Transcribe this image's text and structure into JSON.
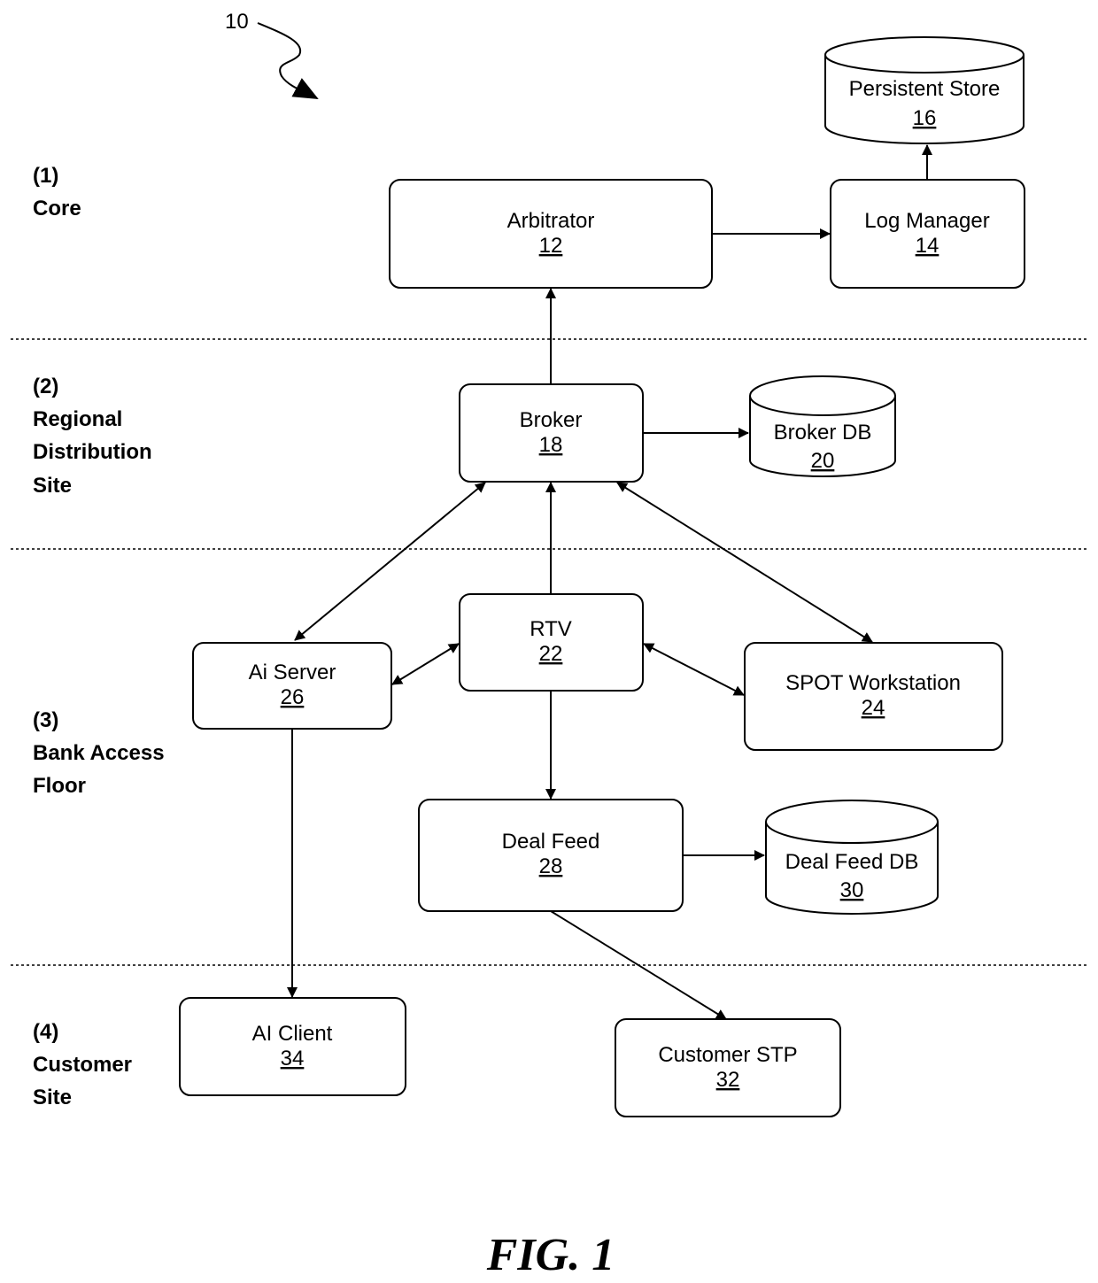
{
  "figure": {
    "caption": "FIG. 1",
    "reference_numeral": "10"
  },
  "tiers": [
    {
      "id": "core",
      "lines": [
        "(1)",
        "Core"
      ]
    },
    {
      "id": "regional",
      "lines": [
        "(2)",
        "Regional",
        "Distribution",
        "Site"
      ]
    },
    {
      "id": "bank",
      "lines": [
        "(3)",
        "Bank Access",
        "Floor"
      ]
    },
    {
      "id": "customer",
      "lines": [
        "(4)",
        "Customer",
        "Site"
      ]
    }
  ],
  "nodes": {
    "arbitrator": {
      "label": "Arbitrator",
      "ref": "12",
      "shape": "box"
    },
    "log_manager": {
      "label": "Log Manager",
      "ref": "14",
      "shape": "box"
    },
    "persistent_store": {
      "label": "Persistent Store",
      "ref": "16",
      "shape": "database"
    },
    "broker": {
      "label": "Broker",
      "ref": "18",
      "shape": "box"
    },
    "broker_db": {
      "label": "Broker DB",
      "ref": "20",
      "shape": "database"
    },
    "rtv": {
      "label": "RTV",
      "ref": "22",
      "shape": "box"
    },
    "spot_workstation": {
      "label": "SPOT Workstation",
      "ref": "24",
      "shape": "box"
    },
    "ai_server": {
      "label": "Ai Server",
      "ref": "26",
      "shape": "box"
    },
    "deal_feed": {
      "label": "Deal Feed",
      "ref": "28",
      "shape": "box"
    },
    "deal_feed_db": {
      "label": "Deal Feed DB",
      "ref": "30",
      "shape": "database"
    },
    "customer_stp": {
      "label": "Customer STP",
      "ref": "32",
      "shape": "box"
    },
    "ai_client": {
      "label": "AI Client",
      "ref": "34",
      "shape": "box"
    }
  },
  "edges": [
    {
      "from": "arbitrator",
      "to": "log_manager",
      "direction": "forward"
    },
    {
      "from": "log_manager",
      "to": "persistent_store",
      "direction": "forward"
    },
    {
      "from": "broker",
      "to": "arbitrator",
      "direction": "forward"
    },
    {
      "from": "broker",
      "to": "broker_db",
      "direction": "forward"
    },
    {
      "from": "ai_server",
      "to": "broker",
      "direction": "both"
    },
    {
      "from": "rtv",
      "to": "broker",
      "direction": "forward"
    },
    {
      "from": "spot_workstation",
      "to": "broker",
      "direction": "both"
    },
    {
      "from": "ai_server",
      "to": "rtv",
      "direction": "both"
    },
    {
      "from": "rtv",
      "to": "spot_workstation",
      "direction": "both"
    },
    {
      "from": "rtv",
      "to": "deal_feed",
      "direction": "forward"
    },
    {
      "from": "deal_feed",
      "to": "deal_feed_db",
      "direction": "forward"
    },
    {
      "from": "deal_feed",
      "to": "customer_stp",
      "direction": "forward"
    },
    {
      "from": "ai_server",
      "to": "ai_client",
      "direction": "forward"
    }
  ]
}
